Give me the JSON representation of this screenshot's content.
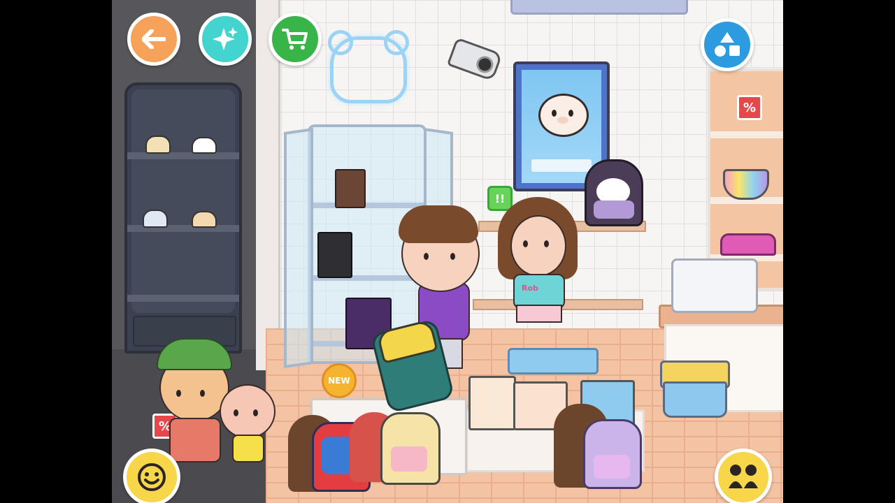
{
  "window": {
    "frame_color": "#000000"
  },
  "hud": {
    "back_button": {
      "icon": "arrow-left-icon",
      "color": "#f7a25a"
    },
    "magic_button": {
      "icon": "sparkle-icon",
      "color": "#44d4d0"
    },
    "shop_button": {
      "icon": "cart-icon",
      "color": "#39b449"
    },
    "shapes_button": {
      "icon": "shapes-icon",
      "color": "#2d9be0"
    },
    "character_button": {
      "icon": "face-icon",
      "color": "#f7d64a"
    },
    "family_button": {
      "icon": "people-icon",
      "color": "#f7d64a"
    }
  },
  "store": {
    "sale_sign": "%",
    "sale_sign_2": "%",
    "new_badge": "NEW",
    "exclamation_sign": "!!",
    "shirt_text": "Rob",
    "bear_poster": {
      "icon": "bear-icon"
    },
    "neon_sign": {
      "icon": "bear-outline-icon"
    }
  }
}
